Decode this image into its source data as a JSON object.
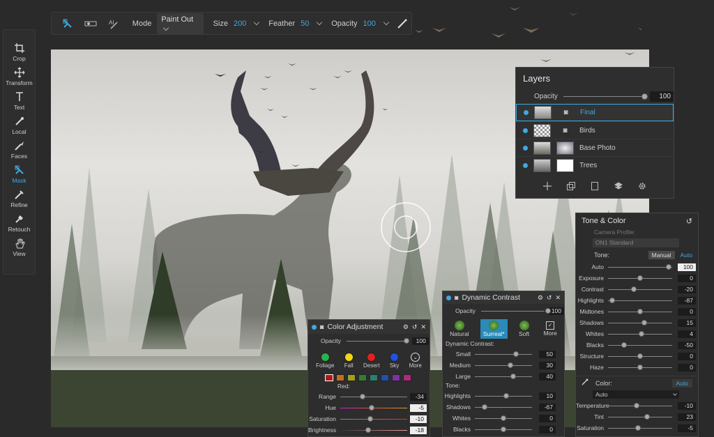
{
  "toolbar": {
    "mode_label": "Mode",
    "mode_value": "Paint Out",
    "size_label": "Size",
    "size_value": "200",
    "feather_label": "Feather",
    "feather_value": "50",
    "opacity_label": "Opacity",
    "opacity_value": "100",
    "icons": [
      "mask-brush-icon",
      "gradient-mask-icon",
      "ai-mask-icon",
      "perfect-brush-icon"
    ]
  },
  "tools": [
    {
      "name": "crop",
      "label": "Crop",
      "icon": "crop-icon"
    },
    {
      "name": "transform",
      "label": "Transform",
      "icon": "move-icon"
    },
    {
      "name": "text",
      "label": "Text",
      "icon": "text-icon"
    },
    {
      "name": "local",
      "label": "Local",
      "icon": "brush-icon"
    },
    {
      "name": "faces",
      "label": "Faces",
      "icon": "faces-icon"
    },
    {
      "name": "mask",
      "label": "Mask",
      "icon": "mask-icon",
      "active": true
    },
    {
      "name": "refine",
      "label": "Refine",
      "icon": "refine-icon"
    },
    {
      "name": "retouch",
      "label": "Retouch",
      "icon": "retouch-icon"
    },
    {
      "name": "view",
      "label": "View",
      "icon": "hand-icon"
    }
  ],
  "layers": {
    "title": "Layers",
    "opacity_label": "Opacity",
    "opacity_value": "100",
    "items": [
      {
        "name": "Final",
        "selected": true
      },
      {
        "name": "Birds"
      },
      {
        "name": "Base Photo"
      },
      {
        "name": "Trees"
      }
    ]
  },
  "tone_color": {
    "title": "Tone & Color",
    "camera_profile_label": "Camera Profile:",
    "camera_profile_value": "ON1 Standard",
    "tone_label": "Tone:",
    "manual_label": "Manual",
    "auto_label": "Auto",
    "rows": [
      {
        "label": "Auto",
        "value": "100",
        "pos": 0.95
      },
      {
        "label": "Exposure",
        "value": "0",
        "pos": 0.5
      },
      {
        "label": "Contrast",
        "value": "-20",
        "pos": 0.4
      },
      {
        "label": "Highlights",
        "value": "-87",
        "pos": 0.06
      },
      {
        "label": "Midtones",
        "value": "0",
        "pos": 0.5
      },
      {
        "label": "Shadows",
        "value": "15",
        "pos": 0.57
      },
      {
        "label": "Whites",
        "value": "4",
        "pos": 0.52
      },
      {
        "label": "Blacks",
        "value": "-50",
        "pos": 0.25
      },
      {
        "label": "Structure",
        "value": "0",
        "pos": 0.5
      },
      {
        "label": "Haze",
        "value": "0",
        "pos": 0.5
      }
    ],
    "color_label": "Color:",
    "color_auto": "Auto",
    "color_select": "Auto",
    "color_rows": [
      {
        "label": "Temperature",
        "value": "-10",
        "pos": 0.45
      },
      {
        "label": "Tint",
        "value": "23",
        "pos": 0.61
      },
      {
        "label": "Saturation",
        "value": "-5",
        "pos": 0.47
      }
    ]
  },
  "dynamic_contrast": {
    "title": "Dynamic Contrast",
    "opacity_label": "Opacity",
    "opacity_value": "100",
    "presets": [
      "Natural",
      "Surreal*",
      "Soft",
      "More"
    ],
    "section_label": "Dynamic Contrast:",
    "rows": [
      {
        "label": "Small",
        "value": "50",
        "pos": 0.72
      },
      {
        "label": "Medium",
        "value": "30",
        "pos": 0.62
      },
      {
        "label": "Large",
        "value": "40",
        "pos": 0.67
      }
    ],
    "tone_label": "Tone:",
    "tone_rows": [
      {
        "label": "Highlights",
        "value": "10",
        "pos": 0.55
      },
      {
        "label": "Shadows",
        "value": "-67",
        "pos": 0.17
      },
      {
        "label": "Whites",
        "value": "0",
        "pos": 0.5
      },
      {
        "label": "Blacks",
        "value": "0",
        "pos": 0.5
      }
    ]
  },
  "color_adjustment": {
    "title": "Color Adjustment",
    "opacity_label": "Opacity",
    "opacity_value": "100",
    "presets": [
      {
        "label": "Foliage",
        "color": "#2bb24c"
      },
      {
        "label": "Fall",
        "color": "#f2d614"
      },
      {
        "label": "Desert",
        "color": "#e02020"
      },
      {
        "label": "Sky",
        "color": "#2250e0"
      },
      {
        "label": "More",
        "color": "none"
      }
    ],
    "swatches": [
      "#b01818",
      "#c07020",
      "#a0a020",
      "#308030",
      "#2a8070",
      "#2050b0",
      "#8030a0",
      "#b02880"
    ],
    "selected_color": "Red:",
    "rows": [
      {
        "label": "Range",
        "value": "-34",
        "pos": 0.33
      },
      {
        "label": "Hue",
        "value": "-5",
        "pos": 0.47
      },
      {
        "label": "Saturation",
        "value": "-10",
        "pos": 0.45
      },
      {
        "label": "Brightness",
        "value": "-18",
        "pos": 0.42
      }
    ]
  }
}
